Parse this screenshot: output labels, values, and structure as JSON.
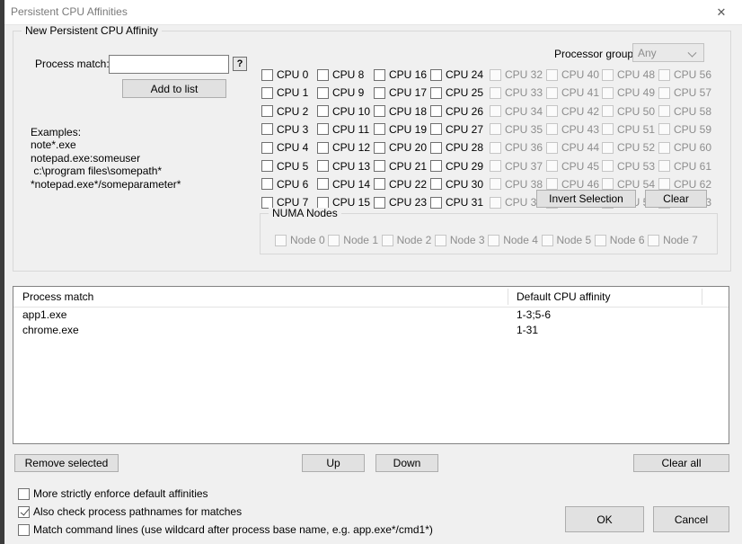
{
  "window": {
    "title": "Persistent CPU Affinities",
    "close_icon": "close-icon"
  },
  "affinity_group": {
    "title": "New Persistent CPU Affinity",
    "process_match_label": "Process match:",
    "process_match_value": "",
    "process_match_placeholder": "",
    "help_button_label": "?",
    "add_to_list_label": "Add to list",
    "examples_label": "Examples:",
    "examples": [
      "note*.exe",
      "notepad.exe:someuser",
      " c:\\program files\\somepath*",
      "*notepad.exe*/someparameter*"
    ],
    "processor_group_label": "Processor group:",
    "processor_group_value": "Any",
    "processor_group_options": [
      "Any"
    ],
    "invert_selection_label": "Invert Selection",
    "clear_label": "Clear"
  },
  "cpu_checkboxes": {
    "columns": [
      {
        "enabled": true,
        "items": [
          "CPU 0",
          "CPU 1",
          "CPU 2",
          "CPU 3",
          "CPU 4",
          "CPU 5",
          "CPU 6",
          "CPU 7"
        ]
      },
      {
        "enabled": true,
        "items": [
          "CPU 8",
          "CPU 9",
          "CPU 10",
          "CPU 11",
          "CPU 12",
          "CPU 13",
          "CPU 14",
          "CPU 15"
        ]
      },
      {
        "enabled": true,
        "items": [
          "CPU 16",
          "CPU 17",
          "CPU 18",
          "CPU 19",
          "CPU 20",
          "CPU 21",
          "CPU 22",
          "CPU 23"
        ]
      },
      {
        "enabled": true,
        "items": [
          "CPU 24",
          "CPU 25",
          "CPU 26",
          "CPU 27",
          "CPU 28",
          "CPU 29",
          "CPU 30",
          "CPU 31"
        ]
      },
      {
        "enabled": false,
        "items": [
          "CPU 32",
          "CPU 33",
          "CPU 34",
          "CPU 35",
          "CPU 36",
          "CPU 37",
          "CPU 38",
          "CPU 39"
        ]
      },
      {
        "enabled": false,
        "items": [
          "CPU 40",
          "CPU 41",
          "CPU 42",
          "CPU 43",
          "CPU 44",
          "CPU 45",
          "CPU 46",
          "CPU 47"
        ]
      },
      {
        "enabled": false,
        "items": [
          "CPU 48",
          "CPU 49",
          "CPU 50",
          "CPU 51",
          "CPU 52",
          "CPU 53",
          "CPU 54",
          "CPU 55"
        ]
      },
      {
        "enabled": false,
        "items": [
          "CPU 56",
          "CPU 57",
          "CPU 58",
          "CPU 59",
          "CPU 60",
          "CPU 61",
          "CPU 62",
          "CPU 63"
        ]
      }
    ]
  },
  "numa_group": {
    "title": "NUMA Nodes",
    "enabled": false,
    "nodes": [
      "Node 0",
      "Node 1",
      "Node 2",
      "Node 3",
      "Node 4",
      "Node 5",
      "Node 6",
      "Node 7"
    ]
  },
  "list": {
    "columns": [
      "Process match",
      "Default CPU affinity"
    ],
    "rows": [
      {
        "process_match": "app1.exe",
        "affinity": "1-3;5-6"
      },
      {
        "process_match": "chrome.exe",
        "affinity": "1-31"
      }
    ]
  },
  "list_buttons": {
    "remove_selected": "Remove selected",
    "up": "Up",
    "down": "Down",
    "clear_all": "Clear all"
  },
  "options": [
    {
      "label": "More strictly enforce default affinities",
      "checked": false
    },
    {
      "label": "Also check process pathnames for matches",
      "checked": true
    },
    {
      "label": "Match command lines (use wildcard after process base name, e.g. app.exe*/cmd1*)",
      "checked": false
    }
  ],
  "dialog_buttons": {
    "ok": "OK",
    "cancel": "Cancel"
  }
}
